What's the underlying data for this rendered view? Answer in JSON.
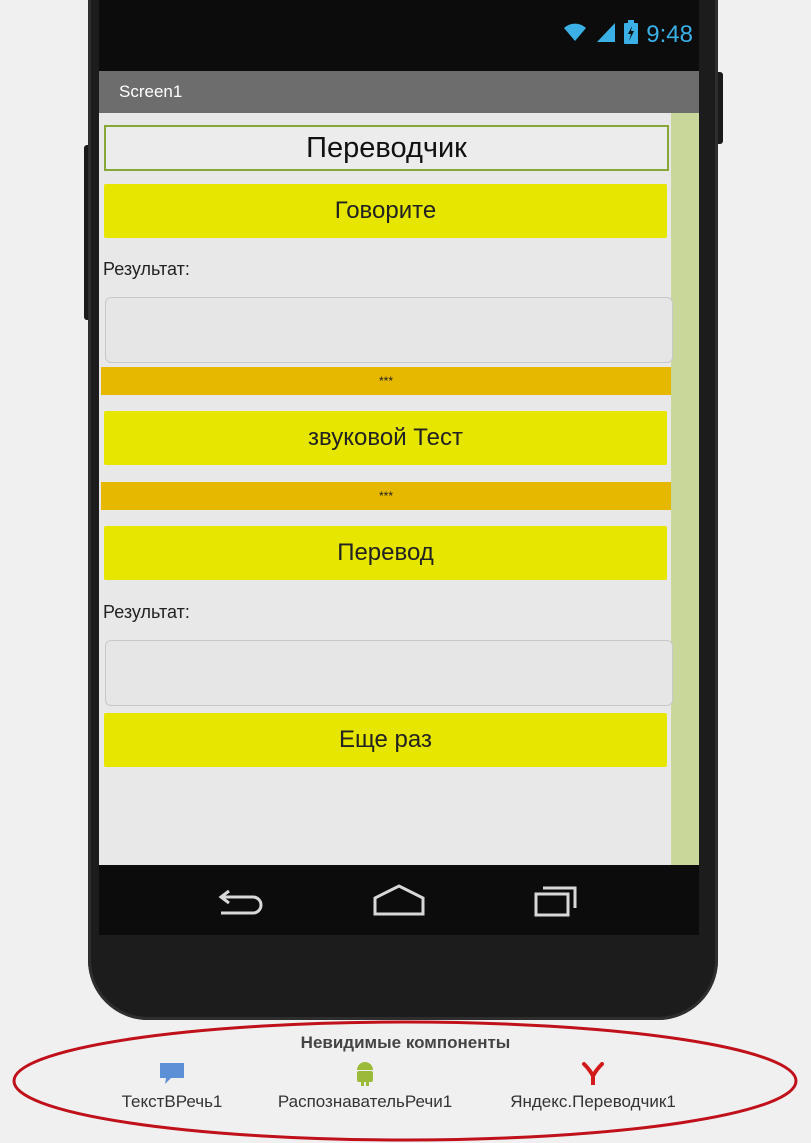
{
  "status_bar": {
    "time": "9:48"
  },
  "app_bar": {
    "title": "Screen1"
  },
  "screen": {
    "heading": "Переводчик",
    "speak_button": "Говорите",
    "result_label_1": "Результат:",
    "divider_1": "***",
    "sound_test_button": "звуковой Тест",
    "divider_2": "***",
    "translate_button": "Перевод",
    "result_label_2": "Результат:",
    "again_button": "Еще раз"
  },
  "invisible_components": {
    "title": "Невидимые компоненты",
    "items": [
      {
        "name": "ТекстВРечь1",
        "icon": "speech-bubble-icon"
      },
      {
        "name": "РаспознавательРечи1",
        "icon": "android-robot-icon"
      },
      {
        "name": "Яндекс.Переводчик1",
        "icon": "yandex-logo-icon"
      }
    ]
  },
  "colors": {
    "button_yellow": "#e6e600",
    "divider_orange": "#e6b800",
    "label_border_green": "#87a838",
    "annotation_red": "#c0101a"
  }
}
